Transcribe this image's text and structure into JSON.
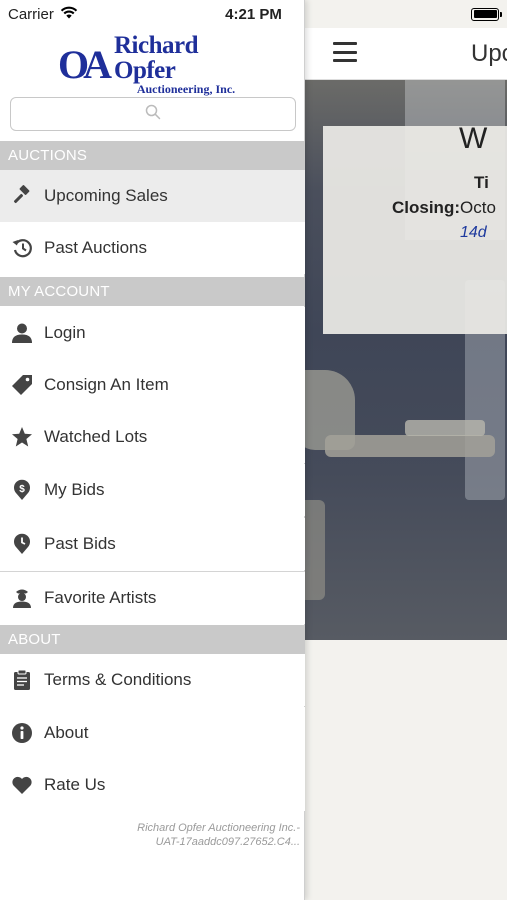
{
  "status_bar": {
    "carrier": "Carrier",
    "time": "4:21 PM"
  },
  "logo": {
    "mark": "OA",
    "name": "Richard Opfer",
    "subtitle": "Auctioneering, Inc."
  },
  "search": {
    "placeholder": ""
  },
  "sections": {
    "auctions": "AUCTIONS",
    "my_account": "MY ACCOUNT",
    "about": "ABOUT"
  },
  "menu": {
    "upcoming_sales": "Upcoming Sales",
    "past_auctions": "Past Auctions",
    "login": "Login",
    "consign": "Consign An Item",
    "watched_lots": "Watched Lots",
    "my_bids": "My Bids",
    "past_bids": "Past Bids",
    "favorite_artists": "Favorite Artists",
    "terms": "Terms & Conditions",
    "about": "About",
    "rate_us": "Rate Us"
  },
  "footer": {
    "line1": "Richard Opfer Auctioneering Inc.-",
    "line2": "UAT-17aaddc097.27652.C4..."
  },
  "main": {
    "title": "Upc",
    "sale_title": "W",
    "sale_row1": "Ti",
    "closing_label": "Closing:",
    "closing_value": "Octo",
    "remaining": "14d"
  },
  "colors": {
    "brand": "#1f2f9a",
    "section_header_bg": "#c9c9c9",
    "active_item_bg": "#ececec",
    "link_blue": "#1e3a9e"
  },
  "icons": {
    "upcoming_sales": "gavel-icon",
    "past_auctions": "history-icon",
    "login": "person-icon",
    "consign": "tag-icon",
    "watched_lots": "star-icon",
    "my_bids": "dollar-pin-icon",
    "past_bids": "clock-pin-icon",
    "favorite_artists": "artist-icon",
    "terms": "clipboard-icon",
    "about": "info-icon",
    "rate_us": "heart-icon"
  }
}
